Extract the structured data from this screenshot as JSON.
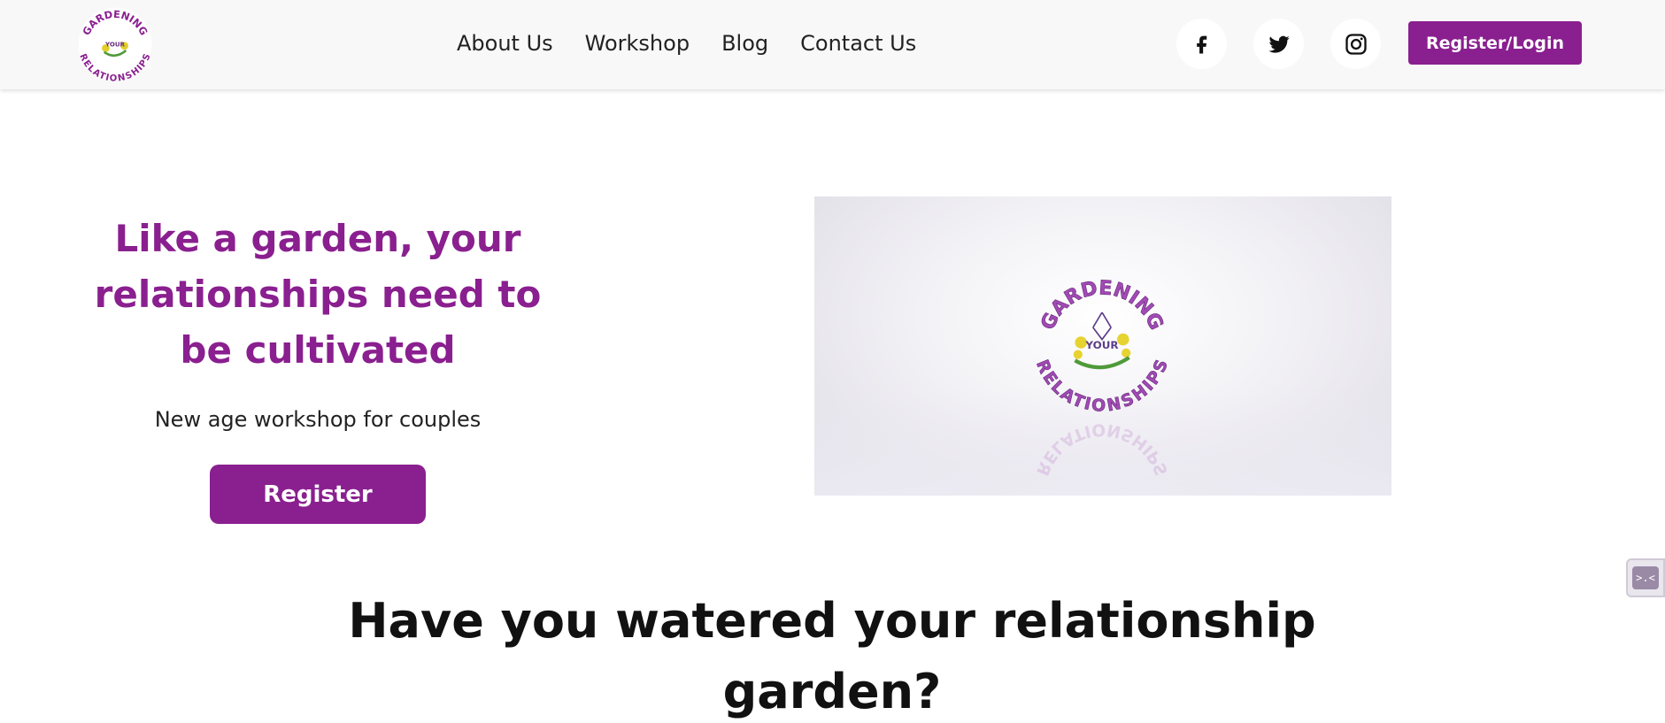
{
  "brand": {
    "logo_top_text": "GARDENING",
    "logo_bottom_text": "RELATIONSHIPS",
    "logo_center_text": "YOUR",
    "color": "#8a1f8f"
  },
  "nav": {
    "items": [
      {
        "label": "About Us"
      },
      {
        "label": "Workshop"
      },
      {
        "label": "Blog"
      },
      {
        "label": "Contact Us"
      }
    ]
  },
  "social": [
    {
      "name": "facebook-icon"
    },
    {
      "name": "twitter-icon"
    },
    {
      "name": "instagram-icon"
    }
  ],
  "header": {
    "login_label": "Register/Login"
  },
  "hero": {
    "title": "Like a garden, your relationships need to be cultivated",
    "subtitle": "New age workshop for couples",
    "register_label": "Register"
  },
  "video": {
    "logo_icon": "gardening-relationships-logo"
  },
  "section": {
    "title": "Have you watered your relationship garden?"
  },
  "widget": {
    "icon": "chat-widget-icon"
  }
}
